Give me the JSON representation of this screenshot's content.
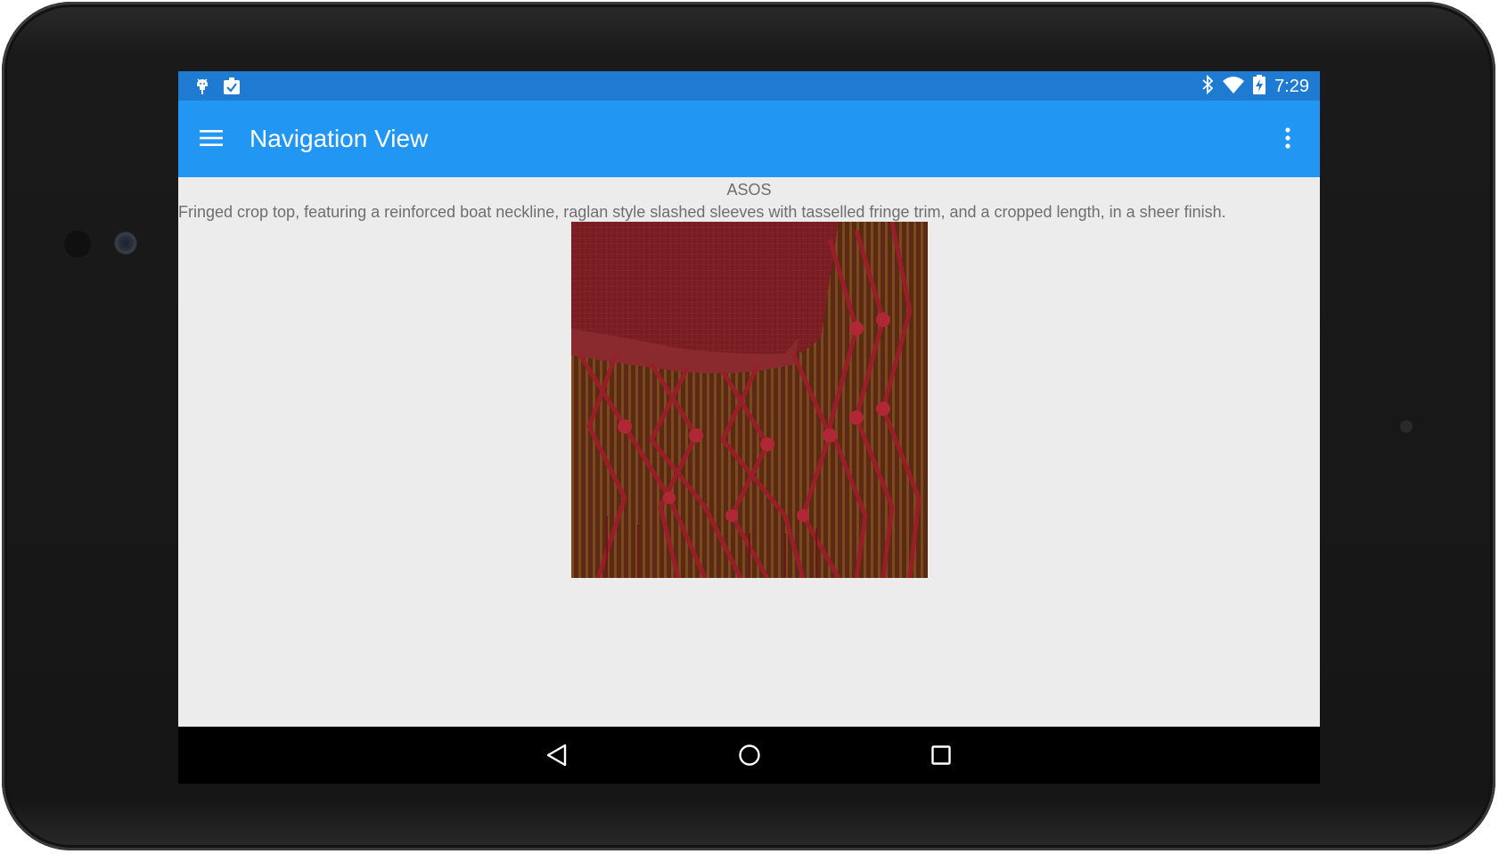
{
  "status_bar": {
    "time": "7:29",
    "left_icons": [
      "android-debug-icon",
      "clipboard-check-icon"
    ],
    "right_icons": [
      "bluetooth-icon",
      "wifi-icon",
      "battery-charging-icon"
    ]
  },
  "app_bar": {
    "title": "Navigation View",
    "menu_icon": "hamburger-menu-icon",
    "overflow_icon": "more-vert-icon",
    "background_color": "#2196f3",
    "status_color": "#1f7ad2"
  },
  "product": {
    "brand": "ASOS",
    "description": "Fringed crop top, featuring a reinforced boat neckline, raglan style slashed sleeves with tasselled fringe trim, and a cropped length, in a sheer finish."
  },
  "nav_bar": {
    "buttons": [
      "back-icon",
      "home-icon",
      "recents-icon"
    ]
  }
}
